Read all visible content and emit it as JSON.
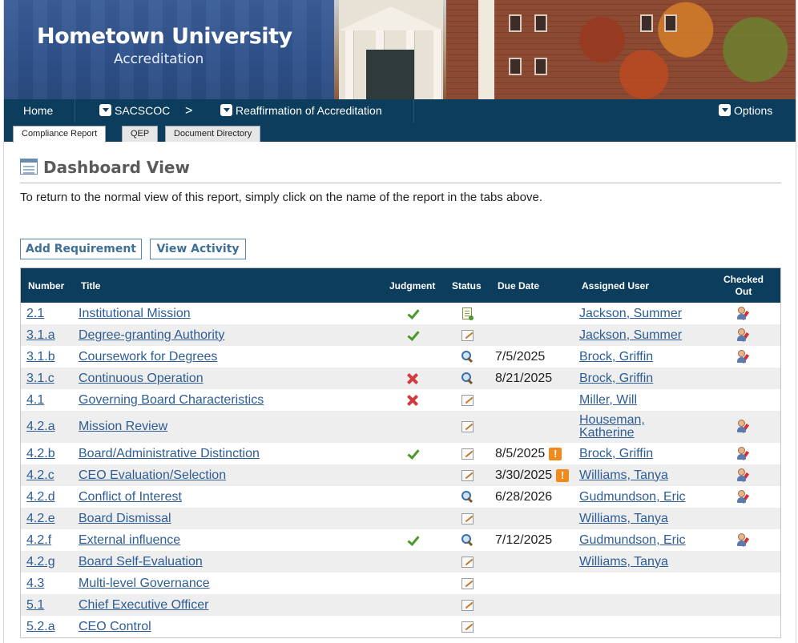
{
  "header": {
    "university": "Hometown University",
    "subtitle": "Accreditation"
  },
  "nav": {
    "home": "Home",
    "sacscoc": "SACSCOC",
    "separator": ">",
    "reaffirmation": "Reaffirmation of Accreditation",
    "options": "Options"
  },
  "tabs": [
    {
      "label": "Compliance Report",
      "active": true
    },
    {
      "label": "QEP",
      "active": false
    },
    {
      "label": "Document Directory",
      "active": false
    }
  ],
  "page": {
    "title": "Dashboard View",
    "intro": "To return to the normal view of this report, simply click on the name of the report in the tabs above."
  },
  "buttons": {
    "add_requirement": "Add Requirement",
    "view_activity": "View Activity"
  },
  "table": {
    "columns": {
      "number": "Number",
      "title": "Title",
      "judgment": "Judgment",
      "status": "Status",
      "due_date": "Due Date",
      "assigned_user": "Assigned User",
      "checked_out_1": "Checked",
      "checked_out_2": "Out"
    },
    "rows": [
      {
        "number": "2.1",
        "title": "Institutional Mission",
        "judgment": "check",
        "status": "approved-doc-icon",
        "due": "",
        "warn": false,
        "user": "Jackson, Summer",
        "checked_out": true
      },
      {
        "number": "3.1.a",
        "title": "Degree-granting Authority",
        "judgment": "check",
        "status": "edit-icon",
        "due": "",
        "warn": false,
        "user": "Jackson, Summer",
        "checked_out": true
      },
      {
        "number": "3.1.b",
        "title": "Coursework for Degrees",
        "judgment": "",
        "status": "review-icon",
        "due": "7/5/2025",
        "warn": false,
        "user": "Brock, Griffin",
        "checked_out": true
      },
      {
        "number": "3.1.c",
        "title": "Continuous Operation",
        "judgment": "x",
        "status": "review-icon",
        "due": "8/21/2025",
        "warn": false,
        "user": "Brock, Griffin",
        "checked_out": false
      },
      {
        "number": "4.1",
        "title": "Governing Board Characteristics",
        "judgment": "x",
        "status": "edit-icon",
        "due": "",
        "warn": false,
        "user": "Miller, Will",
        "checked_out": false
      },
      {
        "number": "4.2.a",
        "title": "Mission Review",
        "judgment": "",
        "status": "edit-icon",
        "due": "",
        "warn": false,
        "user": "Houseman, Katherine",
        "user_line1": "Houseman,",
        "user_line2": "Katherine",
        "checked_out": true
      },
      {
        "number": "4.2.b",
        "title": "Board/Administrative Distinction",
        "judgment": "check",
        "status": "edit-icon",
        "due": "8/5/2025",
        "warn": true,
        "user": "Brock, Griffin",
        "checked_out": true
      },
      {
        "number": "4.2.c",
        "title": "CEO Evaluation/Selection",
        "judgment": "",
        "status": "edit-icon",
        "due": "3/30/2025",
        "warn": true,
        "user": "Williams, Tanya",
        "checked_out": true
      },
      {
        "number": "4.2.d",
        "title": "Conflict of Interest",
        "judgment": "",
        "status": "review-icon",
        "due": "6/28/2026",
        "warn": false,
        "user": "Gudmundson, Eric",
        "checked_out": true
      },
      {
        "number": "4.2.e",
        "title": "Board Dismissal",
        "judgment": "",
        "status": "edit-icon",
        "due": "",
        "warn": false,
        "user": "Williams, Tanya",
        "checked_out": false
      },
      {
        "number": "4.2.f",
        "title": "External influence",
        "judgment": "check",
        "status": "review-icon",
        "due": "7/12/2025",
        "warn": false,
        "user": "Gudmundson, Eric",
        "checked_out": true
      },
      {
        "number": "4.2.g",
        "title": "Board Self-Evaluation",
        "judgment": "",
        "status": "edit-icon",
        "due": "",
        "warn": false,
        "user": "Williams, Tanya",
        "checked_out": false
      },
      {
        "number": "4.3",
        "title": "Multi-level Governance",
        "judgment": "",
        "status": "edit-icon",
        "due": "",
        "warn": false,
        "user": "",
        "checked_out": false
      },
      {
        "number": "5.1",
        "title": "Chief Executive Officer",
        "judgment": "",
        "status": "edit-icon",
        "due": "",
        "warn": false,
        "user": "",
        "checked_out": false
      },
      {
        "number": "5.2.a",
        "title": "CEO Control",
        "judgment": "",
        "status": "edit-icon",
        "due": "",
        "warn": false,
        "user": "",
        "checked_out": false
      }
    ],
    "warn_glyph": "!"
  },
  "colors": {
    "nav": "#0c3d5c",
    "link": "#2d5d94",
    "check": "#4a9a2a",
    "cross": "#d23c3c",
    "warning": "#f08a1c"
  }
}
